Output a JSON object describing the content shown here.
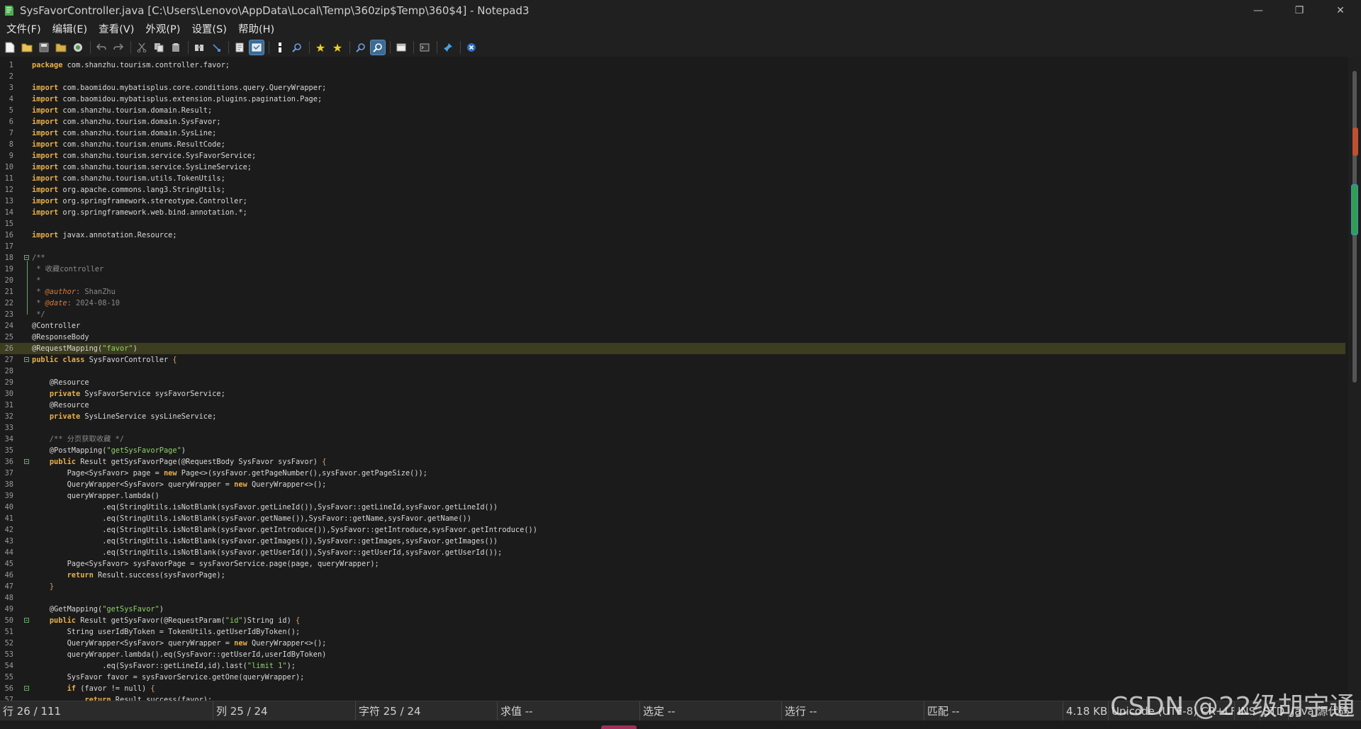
{
  "window": {
    "title": "SysFavorController.java [C:\\Users\\Lenovo\\AppData\\Local\\Temp\\360zip$Temp\\360$4] - Notepad3",
    "minimize_glyph": "—",
    "maximize_glyph": "❐",
    "close_glyph": "✕"
  },
  "menu": [
    "文件(F)",
    "编辑(E)",
    "查看(V)",
    "外观(P)",
    "设置(S)",
    "帮助(H)"
  ],
  "toolbar": {
    "icons": [
      "new-file-icon",
      "open-file-icon",
      "save-icon",
      "save-as-icon",
      "browse-icon",
      "undo-icon",
      "redo-icon",
      "cut-icon",
      "copy-icon",
      "paste-icon",
      "find-icon",
      "replace-icon",
      "word-wrap-icon",
      "view-mode-icon",
      "goto-icon",
      "find-next-icon",
      "star-icon",
      "star-all-icon",
      "zoom-in-icon",
      "zoom-out-icon",
      "window-icon",
      "terminal-icon",
      "pin-icon",
      "exit-icon"
    ],
    "accent": "#3d6b92"
  },
  "editor": {
    "current_line": 26,
    "lines": [
      {
        "n": "1",
        "t": "package com.shanzhu.tourism.controller.favor;"
      },
      {
        "n": "2",
        "t": ""
      },
      {
        "n": "3",
        "t": "import com.baomidou.mybatisplus.core.conditions.query.QueryWrapper;"
      },
      {
        "n": "4",
        "t": "import com.baomidou.mybatisplus.extension.plugins.pagination.Page;"
      },
      {
        "n": "5",
        "t": "import com.shanzhu.tourism.domain.Result;"
      },
      {
        "n": "6",
        "t": "import com.shanzhu.tourism.domain.SysFavor;"
      },
      {
        "n": "7",
        "t": "import com.shanzhu.tourism.domain.SysLine;"
      },
      {
        "n": "8",
        "t": "import com.shanzhu.tourism.enums.ResultCode;"
      },
      {
        "n": "9",
        "t": "import com.shanzhu.tourism.service.SysFavorService;"
      },
      {
        "n": "10",
        "t": "import com.shanzhu.tourism.service.SysLineService;"
      },
      {
        "n": "11",
        "t": "import com.shanzhu.tourism.utils.TokenUtils;"
      },
      {
        "n": "12",
        "t": "import org.apache.commons.lang3.StringUtils;"
      },
      {
        "n": "13",
        "t": "import org.springframework.stereotype.Controller;"
      },
      {
        "n": "14",
        "t": "import org.springframework.web.bind.annotation.*;"
      },
      {
        "n": "15",
        "t": ""
      },
      {
        "n": "16",
        "t": "import javax.annotation.Resource;"
      },
      {
        "n": "17",
        "t": ""
      },
      {
        "n": "18",
        "t": "/**"
      },
      {
        "n": "19",
        "t": " * 收藏controller"
      },
      {
        "n": "20",
        "t": " *"
      },
      {
        "n": "21",
        "t": " * @author: ShanZhu"
      },
      {
        "n": "22",
        "t": " * @date: 2024-08-10"
      },
      {
        "n": "23",
        "t": " */"
      },
      {
        "n": "24",
        "t": "@Controller"
      },
      {
        "n": "25",
        "t": "@ResponseBody"
      },
      {
        "n": "26",
        "t": "@RequestMapping(\"favor\")"
      },
      {
        "n": "27",
        "t": "public class SysFavorController {"
      },
      {
        "n": "28",
        "t": ""
      },
      {
        "n": "29",
        "t": "    @Resource"
      },
      {
        "n": "30",
        "t": "    private SysFavorService sysFavorService;"
      },
      {
        "n": "31",
        "t": "    @Resource"
      },
      {
        "n": "32",
        "t": "    private SysLineService sysLineService;"
      },
      {
        "n": "33",
        "t": ""
      },
      {
        "n": "34",
        "t": "    /** 分页获取收藏 */"
      },
      {
        "n": "35",
        "t": "    @PostMapping(\"getSysFavorPage\")"
      },
      {
        "n": "36",
        "t": "    public Result getSysFavorPage(@RequestBody SysFavor sysFavor) {"
      },
      {
        "n": "37",
        "t": "        Page<SysFavor> page = new Page<>(sysFavor.getPageNumber(),sysFavor.getPageSize());"
      },
      {
        "n": "38",
        "t": "        QueryWrapper<SysFavor> queryWrapper = new QueryWrapper<>();"
      },
      {
        "n": "39",
        "t": "        queryWrapper.lambda()"
      },
      {
        "n": "40",
        "t": "                .eq(StringUtils.isNotBlank(sysFavor.getLineId()),SysFavor::getLineId,sysFavor.getLineId())"
      },
      {
        "n": "41",
        "t": "                .eq(StringUtils.isNotBlank(sysFavor.getName()),SysFavor::getName,sysFavor.getName())"
      },
      {
        "n": "42",
        "t": "                .eq(StringUtils.isNotBlank(sysFavor.getIntroduce()),SysFavor::getIntroduce,sysFavor.getIntroduce())"
      },
      {
        "n": "43",
        "t": "                .eq(StringUtils.isNotBlank(sysFavor.getImages()),SysFavor::getImages,sysFavor.getImages())"
      },
      {
        "n": "44",
        "t": "                .eq(StringUtils.isNotBlank(sysFavor.getUserId()),SysFavor::getUserId,sysFavor.getUserId());"
      },
      {
        "n": "45",
        "t": "        Page<SysFavor> sysFavorPage = sysFavorService.page(page, queryWrapper);"
      },
      {
        "n": "46",
        "t": "        return Result.success(sysFavorPage);"
      },
      {
        "n": "47",
        "t": "    }"
      },
      {
        "n": "48",
        "t": ""
      },
      {
        "n": "49",
        "t": "    @GetMapping(\"getSysFavor\")"
      },
      {
        "n": "50",
        "t": "    public Result getSysFavor(@RequestParam(\"id\")String id) {"
      },
      {
        "n": "51",
        "t": "        String userIdByToken = TokenUtils.getUserIdByToken();"
      },
      {
        "n": "52",
        "t": "        QueryWrapper<SysFavor> queryWrapper = new QueryWrapper<>();"
      },
      {
        "n": "53",
        "t": "        queryWrapper.lambda().eq(SysFavor::getUserId,userIdByToken)"
      },
      {
        "n": "54",
        "t": "                .eq(SysFavor::getLineId,id).last(\"limit 1\");"
      },
      {
        "n": "55",
        "t": "        SysFavor favor = sysFavorService.getOne(queryWrapper);"
      },
      {
        "n": "56",
        "t": "        if (favor != null) {"
      },
      {
        "n": "57",
        "t": "            return Result.success(favor);"
      }
    ]
  },
  "status": {
    "line": "行 26 / 111",
    "column": "列 25 / 24",
    "char": "字符 25 / 24",
    "value": "求值 --",
    "selection": "选定 --",
    "sel_lines": "选行 --",
    "match": "匹配 --",
    "size": "4.18 KB",
    "encoding": "Unicode (UTF-8)",
    "eol": "CR+LF",
    "ins": "INS",
    "std": "STD",
    "lang": "Java 源代码"
  },
  "watermark": "CSDN @22级胡宇通"
}
